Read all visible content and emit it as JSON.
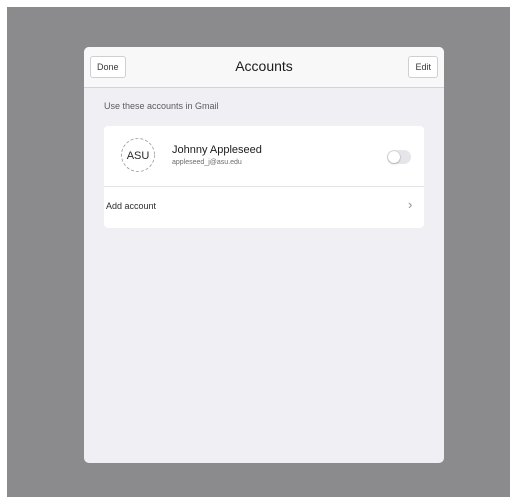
{
  "header": {
    "title": "Accounts",
    "done_label": "Done",
    "edit_label": "Edit"
  },
  "section_header": "Use these accounts in Gmail",
  "accounts": [
    {
      "avatar_text": "ASU",
      "name": "Johnny Appleseed",
      "email": "appleseed_j@asu.edu",
      "enabled": false
    }
  ],
  "add_account_label": "Add account",
  "colors": {
    "backdrop": "#8b8b8d",
    "sheet": "#efeff4",
    "card": "#ffffff",
    "toggle_off": "#e5e5ea"
  },
  "icons": {
    "avatar": "asu-logo-icon",
    "toggle": "toggle-switch-icon",
    "chevron": "chevron-right-icon"
  }
}
